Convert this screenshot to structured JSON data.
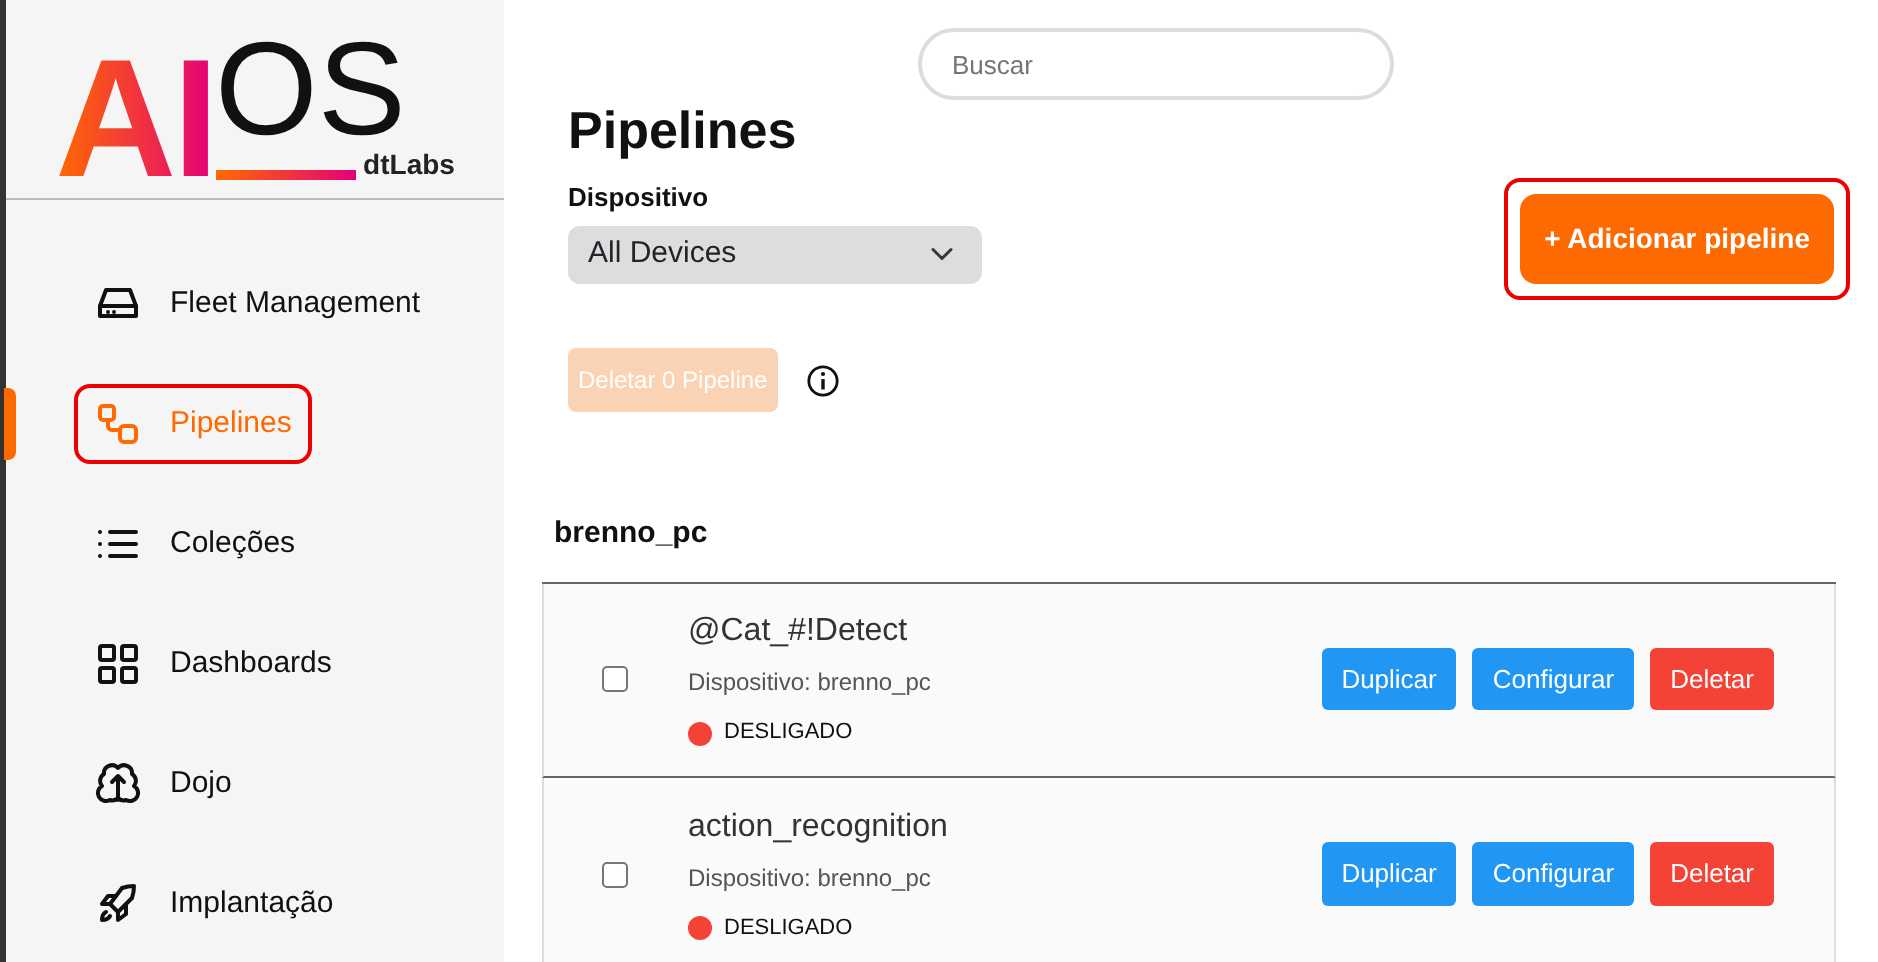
{
  "logo": {
    "main": "AI",
    "sub": "OS",
    "brand": "dtLabs"
  },
  "sidebar": {
    "items": [
      {
        "label": "Fleet Management",
        "selected": false,
        "highlighted": false
      },
      {
        "label": "Pipelines",
        "selected": true,
        "highlighted": true
      },
      {
        "label": "Coleções",
        "selected": false,
        "highlighted": false
      },
      {
        "label": "Dashboards",
        "selected": false,
        "highlighted": false
      },
      {
        "label": "Dojo",
        "selected": false,
        "highlighted": false
      },
      {
        "label": "Implantação",
        "selected": false,
        "highlighted": false
      }
    ]
  },
  "search": {
    "placeholder": "Buscar"
  },
  "page_title": "Pipelines",
  "device_filter": {
    "label": "Dispositivo",
    "value": "All Devices"
  },
  "add_button": {
    "label": "+ Adicionar pipeline",
    "highlighted": true
  },
  "bulk_delete": {
    "label": "Deletar 0 Pipeline",
    "disabled": true
  },
  "groups": [
    {
      "name": "brenno_pc",
      "pipelines": [
        {
          "name": "@Cat_#!Detect",
          "device": "Dispositivo: brenno_pc",
          "status": "DESLIGADO",
          "color": "#f44336",
          "checked": false,
          "actions": [
            "Duplicar",
            "Configurar",
            "Deletar"
          ]
        },
        {
          "name": "action_recognition",
          "device": "Dispositivo: brenno_pc",
          "status": "DESLIGADO",
          "color": "#f44336",
          "checked": false,
          "actions": [
            "Duplicar",
            "Configurar",
            "Deletar"
          ]
        }
      ]
    }
  ]
}
